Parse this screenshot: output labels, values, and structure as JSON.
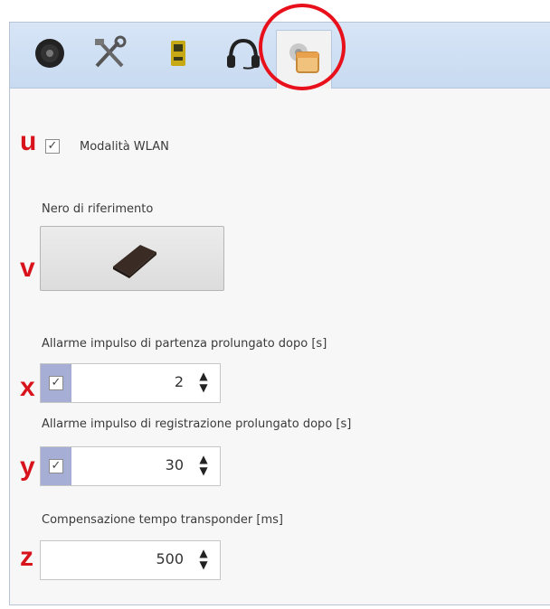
{
  "tabs": [
    {
      "icon": "target-icon"
    },
    {
      "icon": "tools-icon"
    },
    {
      "icon": "transponder-icon"
    },
    {
      "icon": "headset-icon"
    },
    {
      "icon": "settings-icon",
      "active": true
    }
  ],
  "markers": {
    "u": "u",
    "v": "v",
    "x": "x",
    "y": "y",
    "z": "z"
  },
  "wlan": {
    "label": "Modalità WLAN",
    "checked": true,
    "check_glyph": "✓"
  },
  "reference_black": {
    "label": "Nero di riferimento"
  },
  "start_alarm": {
    "label": "Allarme impulso di partenza prolungato dopo [s]",
    "enabled": true,
    "check_glyph": "✓",
    "value": "2"
  },
  "registration_alarm": {
    "label": "Allarme impulso di registrazione prolungato dopo [s]",
    "enabled": true,
    "check_glyph": "✓",
    "value": "30"
  },
  "transponder_comp": {
    "label": "Compensazione tempo transponder [ms]",
    "value": "500"
  },
  "spinner_arrows": {
    "up": "▲",
    "down": "▼"
  },
  "colors": {
    "highlight": "#e8101a",
    "marker": "#d8131b",
    "toggle_bg": "#a7aed6"
  }
}
